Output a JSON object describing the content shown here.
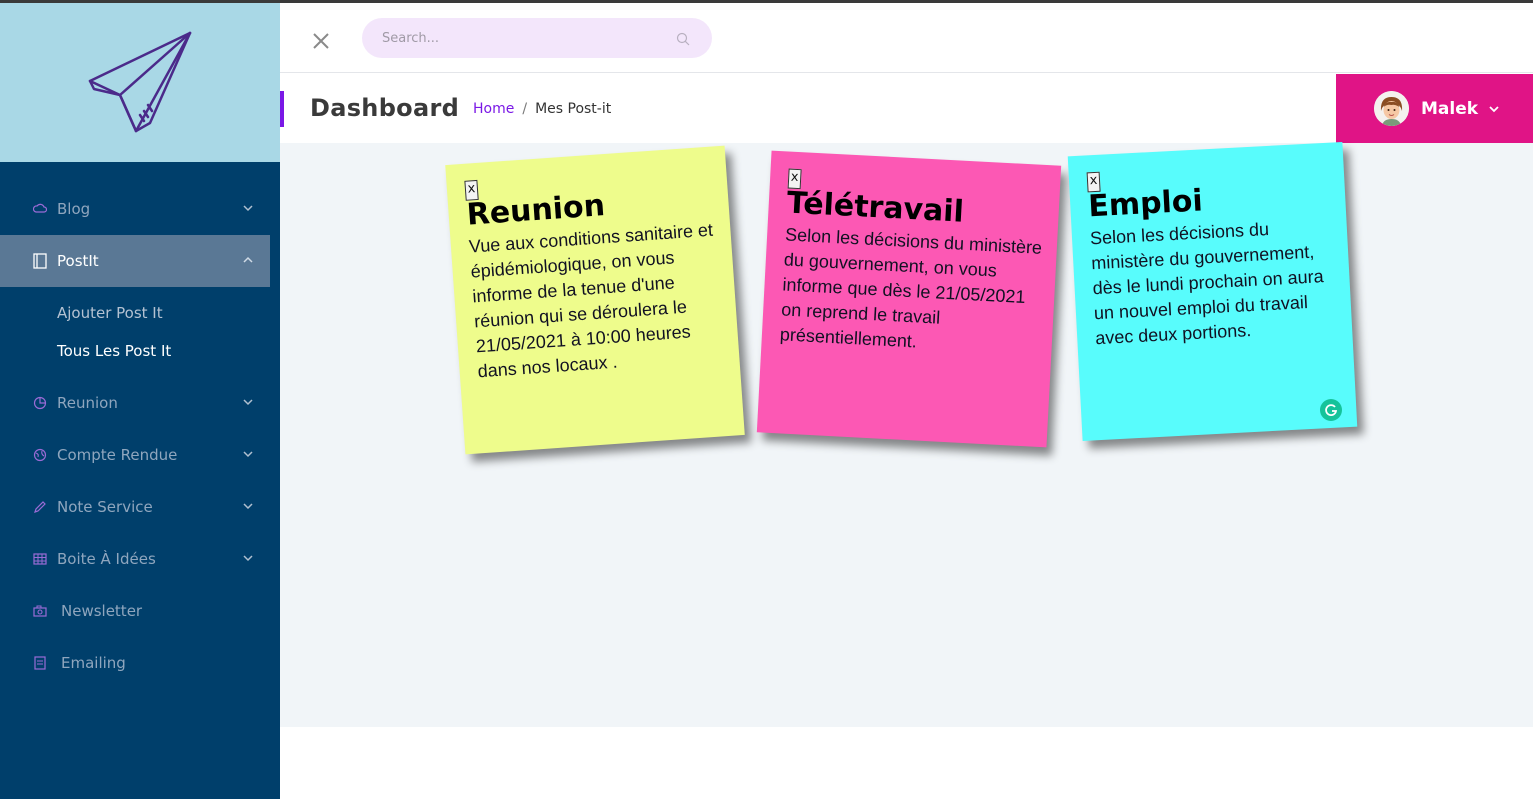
{
  "header": {
    "search_placeholder": "Search..."
  },
  "sidebar": {
    "items": [
      {
        "label": "Blog",
        "icon": "cloud-icon",
        "expandable": true
      },
      {
        "label": "PostIt",
        "icon": "notebook-icon",
        "expandable": true,
        "active": true
      },
      {
        "label": "Reunion",
        "icon": "pie-chart-icon",
        "expandable": true
      },
      {
        "label": "Compte Rendue",
        "icon": "globe-icon",
        "expandable": true
      },
      {
        "label": "Note Service",
        "icon": "pen-icon",
        "expandable": true
      },
      {
        "label": "Boite À Idées",
        "icon": "grid-icon",
        "expandable": true
      },
      {
        "label": "Newsletter",
        "icon": "camera-icon",
        "expandable": false
      },
      {
        "label": "Emailing",
        "icon": "document-icon",
        "expandable": false
      }
    ],
    "postit_sub": [
      {
        "label": "Ajouter Post It"
      },
      {
        "label": "Tous Les Post It",
        "current": true
      }
    ]
  },
  "page": {
    "title": "Dashboard",
    "breadcrumb": {
      "home": "Home",
      "separator": "/",
      "current": "Mes Post-it"
    }
  },
  "user": {
    "name": "Malek"
  },
  "notes": [
    {
      "close": "x",
      "title": "Reunion",
      "body": "Vue aux conditions sanitaire et épidémiologique, on vous informe de la tenue d'une réunion qui se déroulera le 21/05/2021 à 10:00 heures dans nos locaux .",
      "color": "#eefc8c"
    },
    {
      "close": "x",
      "title": "Télétravail",
      "body": "Selon les décisions du ministère du gouvernement, on vous informe que dès le 21/05/2021 on reprend le travail présentiellement.",
      "color": "#fc58b4"
    },
    {
      "close": "x",
      "title": "Emploi",
      "body": "Selon les décisions du ministère du gouvernement, dès le lundi prochain on aura un nouvel emploi du travail avec deux portions.",
      "color": "#58fcfc"
    }
  ],
  "colors": {
    "sidebar_bg": "#003f6b",
    "logo_bg": "#a9d8e6",
    "accent_purple": "#7a18e6",
    "user_box": "#e01486",
    "search_bg": "#f3e6fb"
  }
}
